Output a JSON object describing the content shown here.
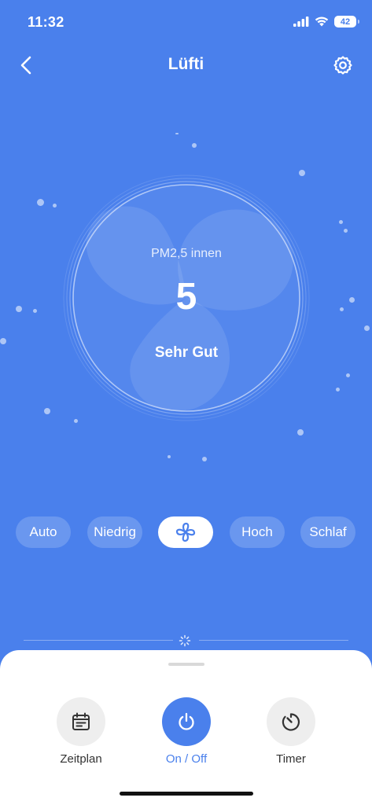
{
  "status_bar": {
    "time": "11:32",
    "battery": "42"
  },
  "nav": {
    "title": "Lüfti"
  },
  "gauge": {
    "label": "PM2,5 innen",
    "value": "5",
    "status": "Sehr Gut"
  },
  "modes": [
    "Auto",
    "Niedrig",
    "fan-icon",
    "Hoch",
    "Schlaf"
  ],
  "actions": {
    "schedule": "Zeitplan",
    "power": "On / Off",
    "timer": "Timer"
  },
  "colors": {
    "background": "#4a80ec",
    "accent": "#4a80ec",
    "sheet": "#ffffff"
  }
}
